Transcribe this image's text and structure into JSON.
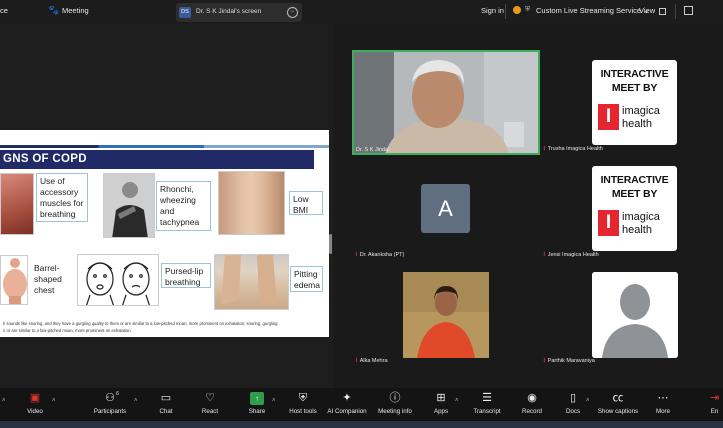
{
  "topbar": {
    "app_fragment": "ce",
    "meeting_tab": "Meeting",
    "share_badge": "DS",
    "share_label": "Dr. S K Jindal's screen",
    "sign_in": "Sign in",
    "live_streaming": "Custom Live Streaming Service",
    "view": "View"
  },
  "slide": {
    "title": "GNS OF COPD",
    "labels": {
      "accessory": "Use of accessory muscles for breathing",
      "rhonchi": "Rhonchi, wheezing and tachypnea",
      "low_bmi": "Low BMI",
      "barrel": "Barrel-shaped chest",
      "pursed": "Pursed-lip breathing",
      "pitting": "Pitting edema"
    },
    "footnote_1": "h sounds like snoring, and they have a gurgling quality to them or are similar to a low-pitched moan, more prominent on exhalation; snoring, gurgling",
    "footnote_2": "n or are similar to a low-pitched moan, more prominent on exhalation."
  },
  "participants": {
    "jindal": "Dr. S K Jindal",
    "trusha": "Trusha Imagica Health",
    "akanksha": "Dr. Akanksha (PT)",
    "akanksha_initial": "A",
    "jensi": "Jensi Imagica Health",
    "alka": "Alka Mehra",
    "parthik": "Parthik Maravaniya"
  },
  "logo": {
    "line1": "INTERACTIVE",
    "line2": "MEET BY",
    "mark": "I",
    "brand1": "imagica",
    "brand2": "health"
  },
  "toolbar": {
    "video": "Video",
    "participants": "Participants",
    "participants_count": "6",
    "chat": "Chat",
    "react": "React",
    "share": "Share",
    "host_tools": "Host tools",
    "ai_companion": "AI Companion",
    "meeting_info": "Meeting info",
    "apps": "Apps",
    "transcript": "Transcript",
    "record": "Record",
    "docs": "Docs",
    "show_captions": "Show captions",
    "more": "More",
    "end": "En"
  },
  "colors": {
    "slide_title_bg": "#1f2a66",
    "active_speaker_border": "#3fae5a",
    "logo_red": "#e5262e",
    "mic_muted": "#e0362c",
    "share_green": "#2e9e4c"
  }
}
